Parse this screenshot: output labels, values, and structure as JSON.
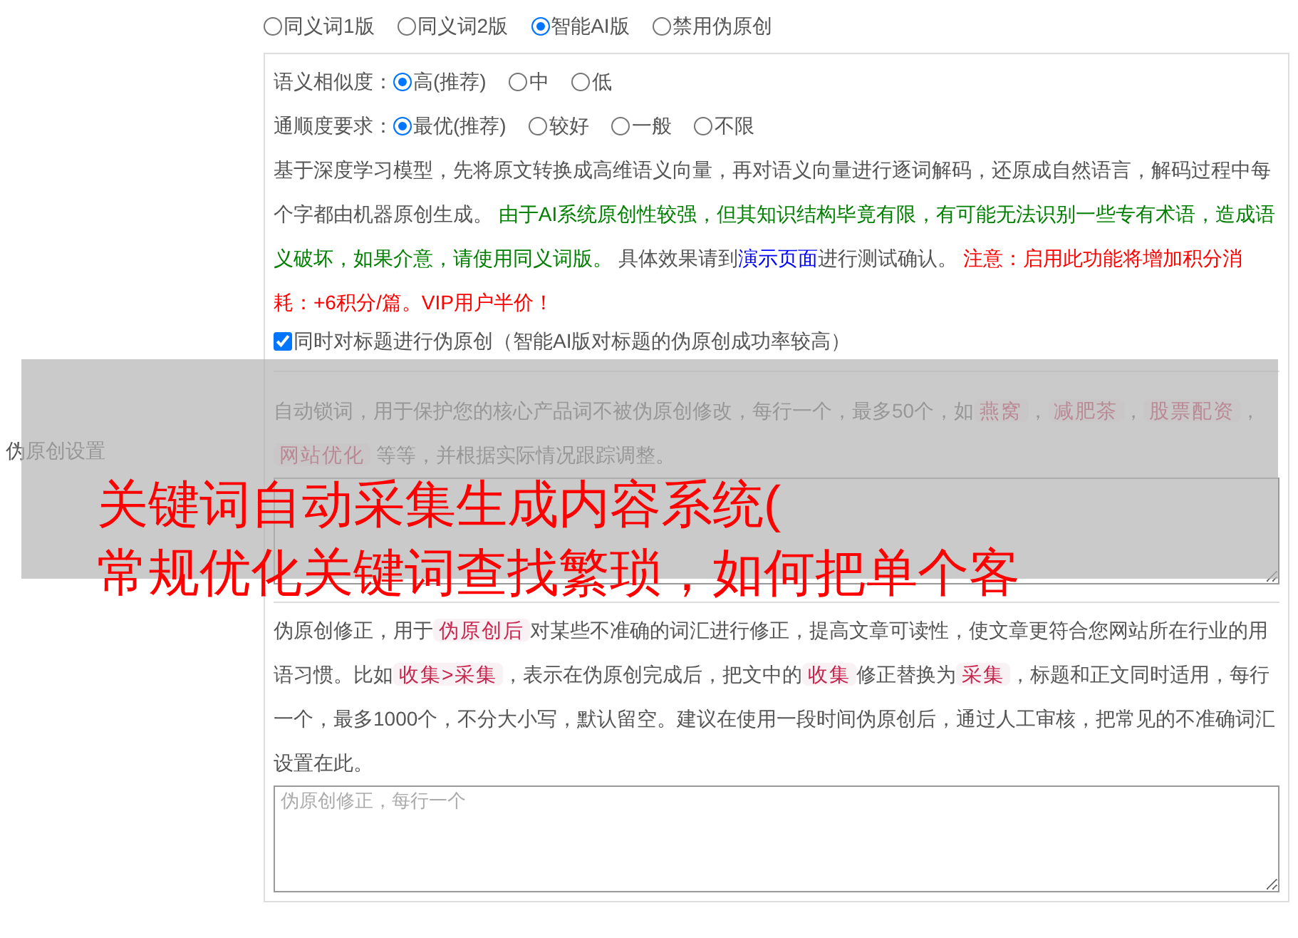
{
  "section_label": "伪原创设置",
  "modes": [
    {
      "label": "同义词1版",
      "selected": false
    },
    {
      "label": "同义词2版",
      "selected": false
    },
    {
      "label": "智能AI版",
      "selected": true
    },
    {
      "label": "禁用伪原创",
      "selected": false
    }
  ],
  "similarity": {
    "label": "语义相似度：",
    "options": [
      {
        "label": "高(推荐)",
        "selected": true
      },
      {
        "label": "中",
        "selected": false
      },
      {
        "label": "低",
        "selected": false
      }
    ]
  },
  "fluency": {
    "label": "通顺度要求：",
    "options": [
      {
        "label": "最优(推荐)",
        "selected": true
      },
      {
        "label": "较好",
        "selected": false
      },
      {
        "label": "一般",
        "selected": false
      },
      {
        "label": "不限",
        "selected": false
      }
    ]
  },
  "ai_description": [
    {
      "kind": "text",
      "text": "基于深度学习模型，先将原文转换成高维语义向量，再对语义向量进行逐词解码，还原成自然语言，解码过程中每个字都由机器原创生成。 "
    },
    {
      "kind": "green",
      "text": "由于AI系统原创性较强，但其知识结构毕竟有限，有可能无法识别一些专有术语，造成语义破坏，如果介意，请使用同义词版。"
    },
    {
      "kind": "text",
      "text": " 具体效果请到"
    },
    {
      "kind": "link",
      "text": "演示页面"
    },
    {
      "kind": "text",
      "text": "进行测试确认。 "
    },
    {
      "kind": "red",
      "text": "注意：启用此功能将增加积分消耗：+6积分/篇。VIP用户半价！"
    }
  ],
  "title_option": {
    "label": "同时对标题进行伪原创（智能AI版对标题的伪原创成功率较高）",
    "checked": true
  },
  "lock_words": {
    "description": [
      {
        "kind": "text",
        "text": "自动锁词，用于保护您的核心产品词不被伪原创修改，每行一个，最多50个，如"
      },
      {
        "kind": "code",
        "text": "燕窝"
      },
      {
        "kind": "text",
        "text": "，"
      },
      {
        "kind": "code",
        "text": "减肥茶"
      },
      {
        "kind": "text",
        "text": "，"
      },
      {
        "kind": "code",
        "text": "股票配资"
      },
      {
        "kind": "text",
        "text": "，"
      },
      {
        "kind": "code",
        "text": "网站优化"
      },
      {
        "kind": "text",
        "text": " 等等，并根据实际情况跟踪调整。"
      }
    ]
  },
  "corrections": {
    "description": [
      {
        "kind": "text",
        "text": "伪原创修正，用于"
      },
      {
        "kind": "code",
        "text": "伪原创后"
      },
      {
        "kind": "text",
        "text": "对某些不准确的词汇进行修正，提高文章可读性，使文章更符合您网站所在行业的用语习惯。比如"
      },
      {
        "kind": "code",
        "text": "收集>采集"
      },
      {
        "kind": "text",
        "text": "，表示在伪原创完成后，把文中的"
      },
      {
        "kind": "code",
        "text": "收集"
      },
      {
        "kind": "text",
        "text": "修正替换为"
      },
      {
        "kind": "code",
        "text": "采集"
      },
      {
        "kind": "text",
        "text": "，标题和正文同时适用，每行一个，最多1000个，不分大小写，默认留空。建议在使用一段时间伪原创后，通过人工审核，把常见的不准确词汇设置在此。"
      }
    ],
    "placeholder": "伪原创修正，每行一个"
  },
  "overlay_title": [
    "关键词自动采集生成内容系统(",
    "常规优化关键词查找繁琐，如何把单个客"
  ]
}
